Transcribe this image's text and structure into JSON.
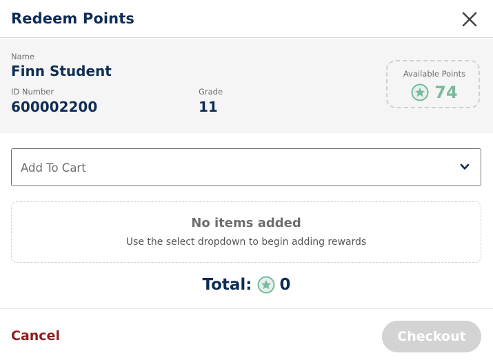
{
  "dialog": {
    "title": "Redeem Points"
  },
  "student": {
    "name_label": "Name",
    "name": "Finn Student",
    "id_label": "ID Number",
    "id": "600002200",
    "grade_label": "Grade",
    "grade": "11"
  },
  "points": {
    "label": "Available Points",
    "value": "74"
  },
  "cart": {
    "select_placeholder": "Add To Cart"
  },
  "empty_state": {
    "title": "No items added",
    "subtitle": "Use the select dropdown to begin adding rewards"
  },
  "total": {
    "label": "Total:",
    "value": "0"
  },
  "footer": {
    "cancel_label": "Cancel",
    "checkout_label": "Checkout"
  },
  "colors": {
    "navy": "#0f2c55",
    "points_green": "#7ab99c",
    "cancel_red": "#8b1f1f",
    "disabled_gray": "#d3d3d3"
  },
  "icons": {
    "close": "close-icon",
    "points": "star-badge-icon",
    "dropdown": "chevron-down-icon"
  }
}
